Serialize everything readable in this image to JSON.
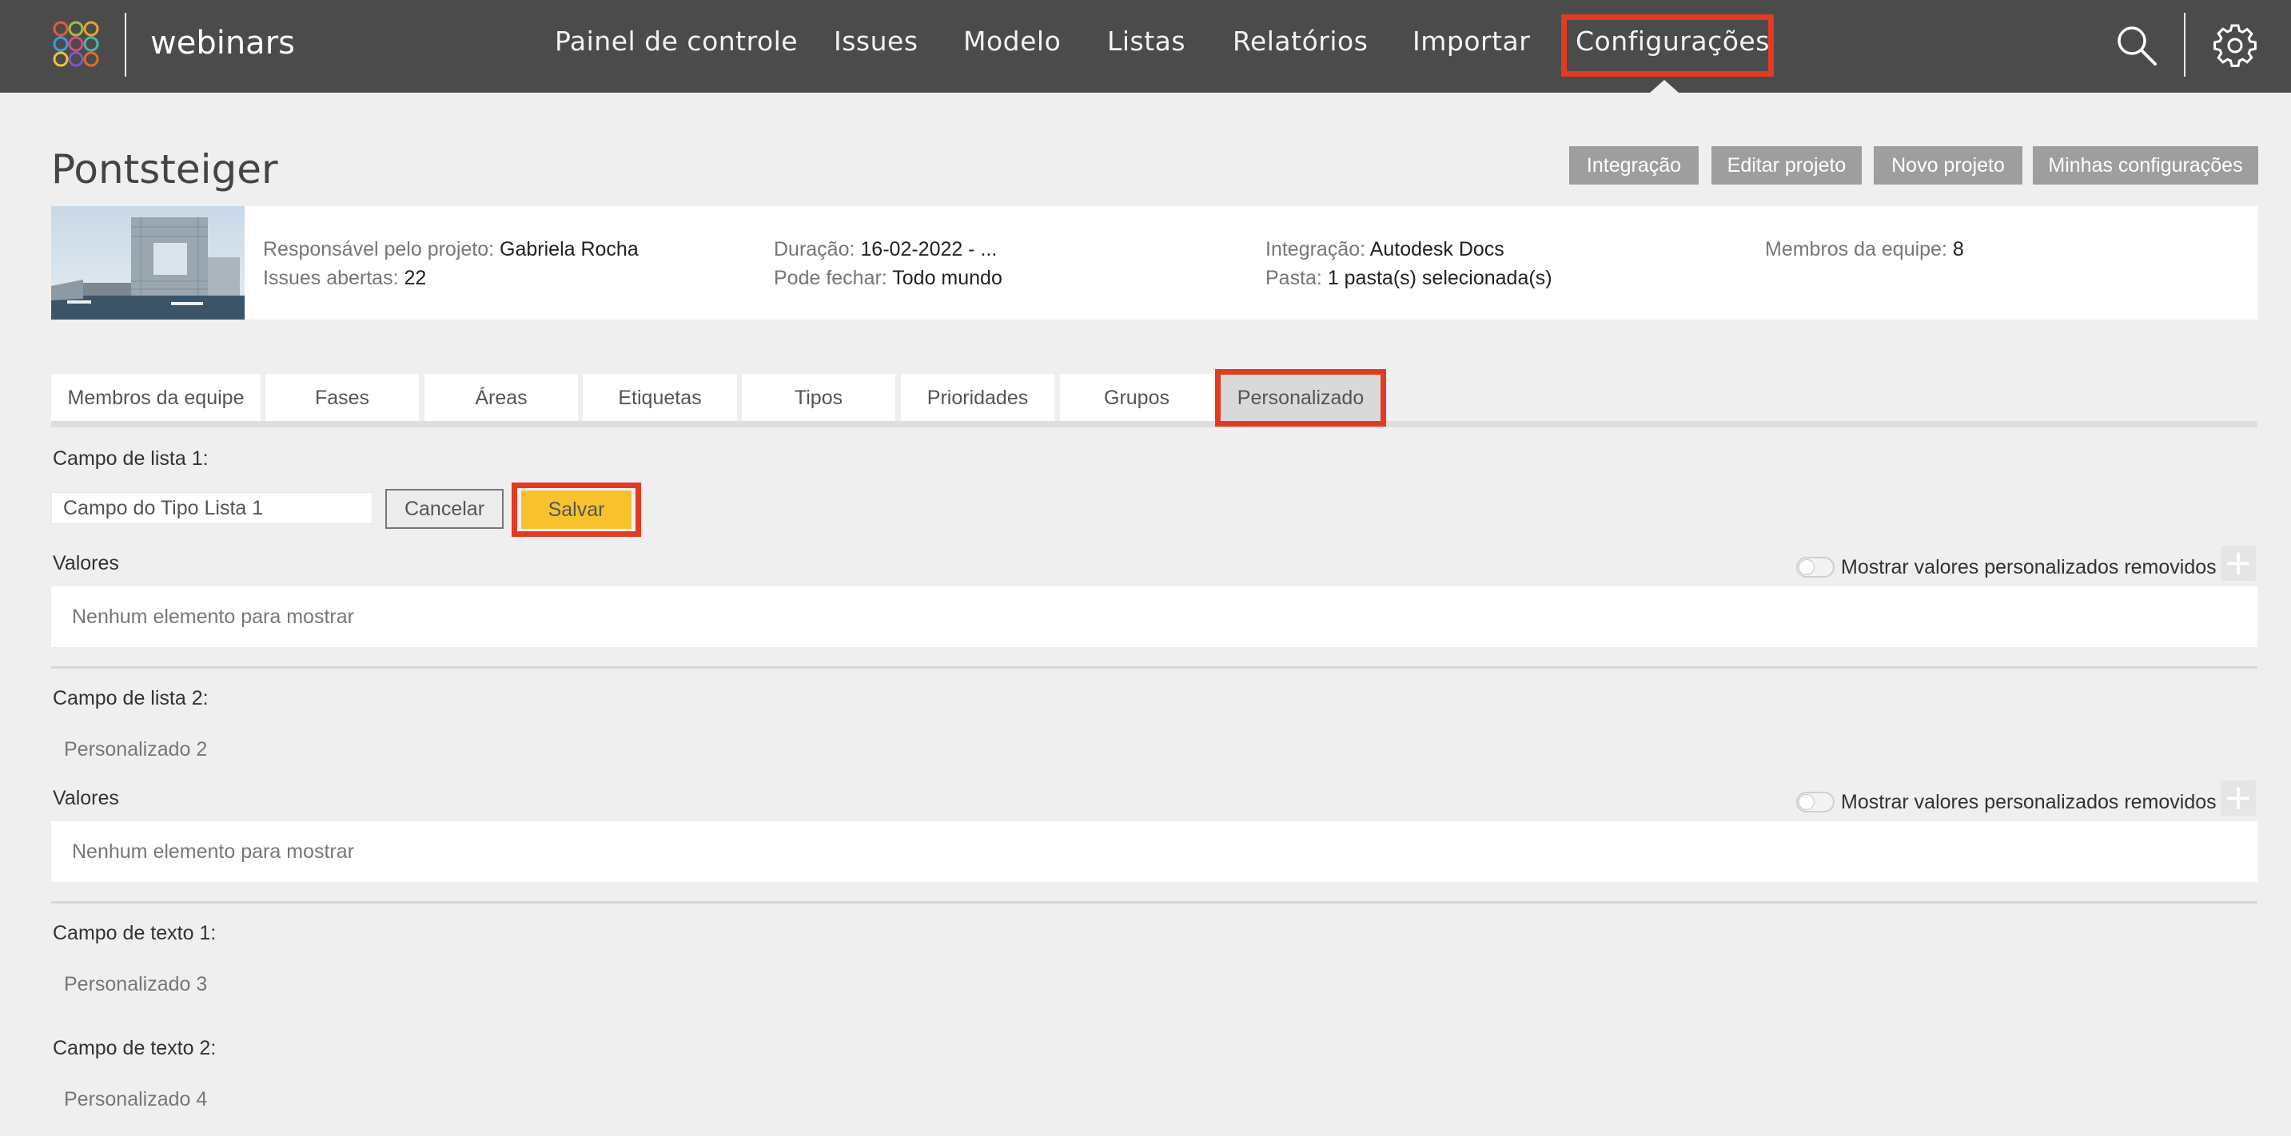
{
  "header": {
    "app_name": "webinars",
    "nav": [
      "Painel de controle",
      "Issues",
      "Modelo",
      "Listas",
      "Relatórios",
      "Importar",
      "Configurações"
    ],
    "active_nav": "Configurações",
    "icons": {
      "search": "search-icon",
      "settings": "gear-icon",
      "logo": "logo-icon"
    }
  },
  "project": {
    "title": "Pontsteiger",
    "actions": [
      "Integração",
      "Editar projeto",
      "Novo projeto",
      "Minhas configurações"
    ],
    "info": {
      "owner_label": "Responsável pelo projeto:",
      "owner": "Gabriela Rocha",
      "issues_label": "Issues abertas:",
      "issues": "22",
      "duration_label": "Duração:",
      "duration": "16-02-2022 - ...",
      "close_label": "Pode fechar:",
      "close": "Todo mundo",
      "integration_label": "Integração:",
      "integration": "Autodesk Docs",
      "folder_label": "Pasta:",
      "folder": "1 pasta(s) selecionada(s)",
      "members_label": "Membros da equipe:",
      "members": "8"
    }
  },
  "tabs": [
    "Membros da equipe",
    "Fases",
    "Áreas",
    "Etiquetas",
    "Tipos",
    "Prioridades",
    "Grupos",
    "Personalizado"
  ],
  "active_tab": "Personalizado",
  "custom": {
    "list1": {
      "label": "Campo de lista 1:",
      "input_value": "Campo do Tipo Lista 1",
      "cancel": "Cancelar",
      "save": "Salvar",
      "values_label": "Valores",
      "toggle_label": "Mostrar valores personalizados removidos",
      "toggle_on": false,
      "empty": "Nenhum elemento para mostrar",
      "add": "+"
    },
    "list2": {
      "label": "Campo de lista 2:",
      "name": "Personalizado 2",
      "values_label": "Valores",
      "toggle_label": "Mostrar valores personalizados removidos",
      "toggle_on": false,
      "empty": "Nenhum elemento para mostrar",
      "add": "+"
    },
    "text1": {
      "label": "Campo de texto 1:",
      "name": "Personalizado 3"
    },
    "text2": {
      "label": "Campo de texto 2:",
      "name": "Personalizado 4"
    }
  },
  "colors": {
    "topbar": "#4b4b4b",
    "highlight": "#e23b22",
    "save": "#f7c22e",
    "header_button": "#9e9e9e"
  }
}
